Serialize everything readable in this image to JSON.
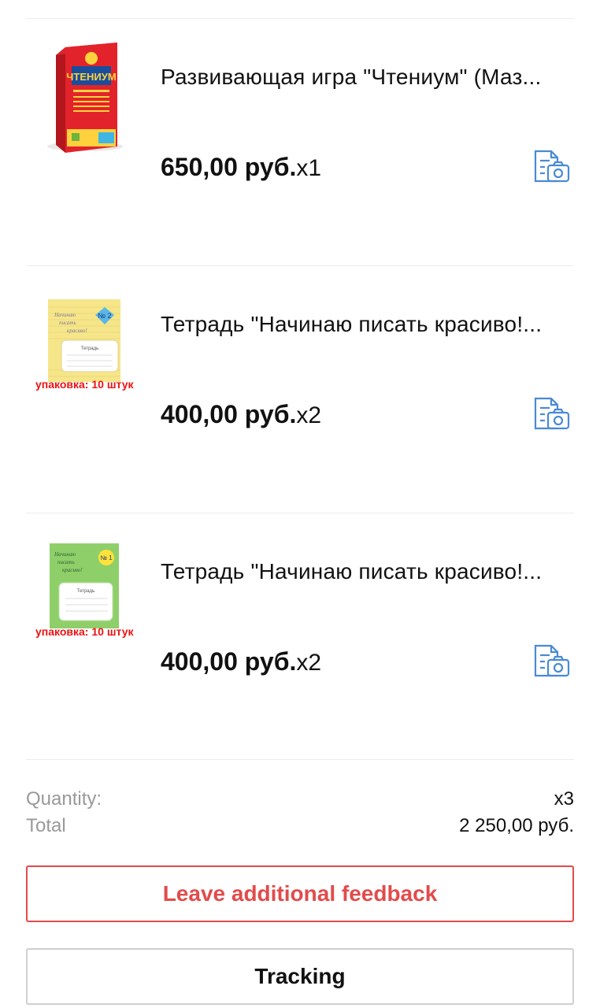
{
  "items": [
    {
      "title": "Развивающая игра \"Чтениум\" (Маз...",
      "price": "650,00 руб.",
      "qty": "x1",
      "image_icon": "game-box-chtenium",
      "box_text": "ЧТЕНИУМ"
    },
    {
      "title": "Тетрадь \"Начинаю писать красиво!...",
      "price": "400,00 руб.",
      "qty": "x2",
      "image_icon": "notebook-yellow",
      "cover_badge": "№ 2",
      "cover_caption": "Тетрадь",
      "cover_title": "Начинаю писать красиво!",
      "pack_label": "упаковка: 10 штук"
    },
    {
      "title": "Тетрадь \"Начинаю писать красиво!...",
      "price": "400,00 руб.",
      "qty": "x2",
      "image_icon": "notebook-green",
      "cover_badge": "№ 1",
      "cover_caption": "Тетрадь",
      "cover_title": "Начинаю писать красиво!",
      "pack_label": "упаковка: 10 штук"
    }
  ],
  "summary": {
    "quantity_label": "Quantity:",
    "quantity_value": "x3",
    "total_label": "Total",
    "total_value": "2 250,00 руб."
  },
  "buttons": {
    "feedback_label": "Leave additional feedback",
    "tracking_label": "Tracking"
  },
  "colors": {
    "accent_red": "#e24b4b",
    "icon_blue": "#4a8ad4",
    "divider": "#ececec"
  }
}
